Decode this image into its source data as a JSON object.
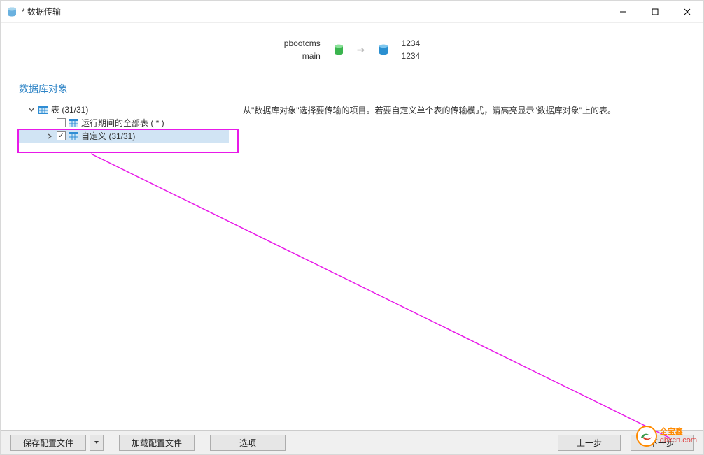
{
  "window": {
    "title": "* 数据传输"
  },
  "summary": {
    "source_top": "pbootcms",
    "source_bottom": "main",
    "target_top": "1234",
    "target_bottom": "1234"
  },
  "section": {
    "title": "数据库对象"
  },
  "tree": {
    "root_label": "表 (31/31)",
    "child_all": "运行期间的全部表 ( * )",
    "child_custom": "自定义 (31/31)"
  },
  "hint": "从\"数据库对象\"选择要传输的项目。若要自定义单个表的传输模式，请高亮显示\"数据库对象\"上的表。",
  "footer": {
    "save": "保存配置文件",
    "load": "加载配置文件",
    "options": "选项",
    "prev": "上一步",
    "next": "下一步"
  },
  "watermark": {
    "top": "全宝鑫",
    "bottom": "qbxcn.com"
  }
}
